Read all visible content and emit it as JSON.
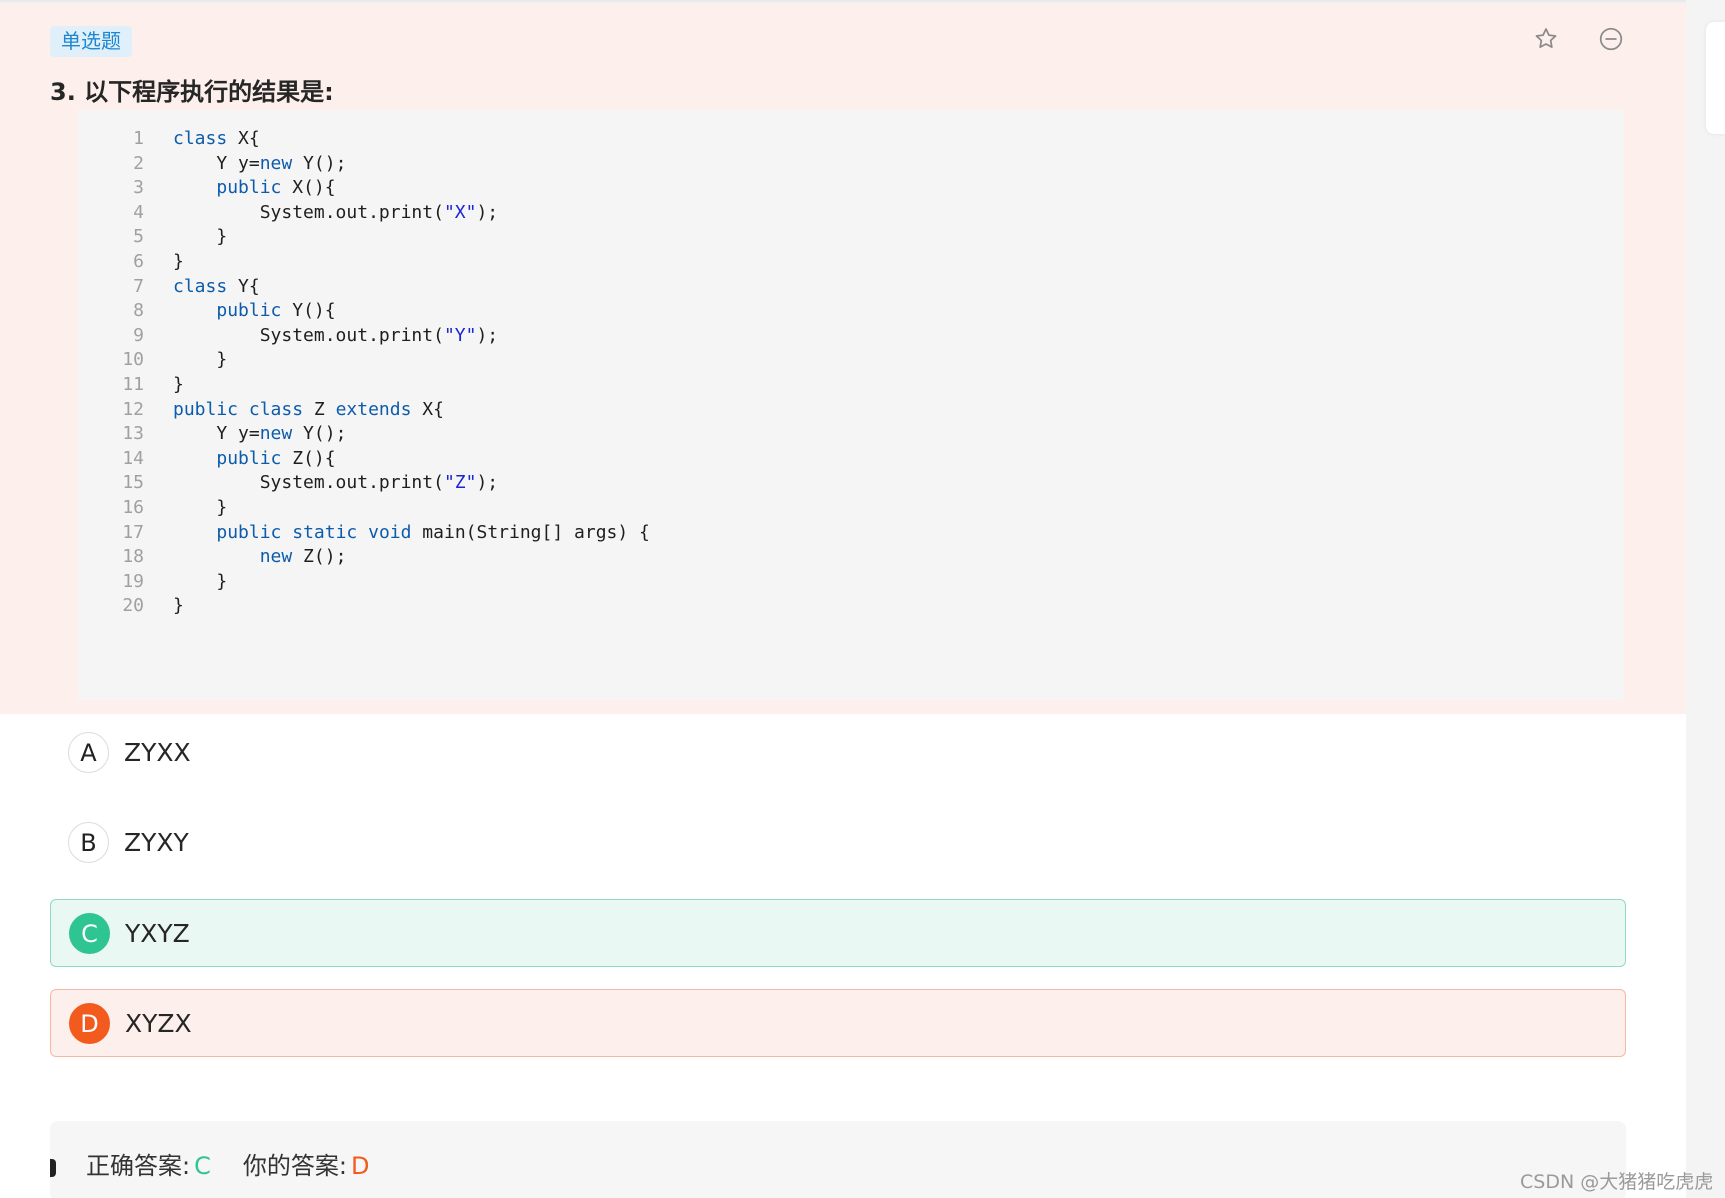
{
  "question": {
    "type_tag": "单选题",
    "title": "3. 以下程序执行的结果是:",
    "favorite_icon": "star-outline-icon",
    "remove_icon": "minus-circle-icon"
  },
  "code_lines": [
    {
      "n": "1",
      "tokens": [
        {
          "k": "kw",
          "t": "class"
        },
        {
          "k": "",
          "t": " X{"
        }
      ]
    },
    {
      "n": "2",
      "tokens": [
        {
          "k": "",
          "t": "    Y y="
        },
        {
          "k": "kw",
          "t": "new"
        },
        {
          "k": "",
          "t": " Y();"
        }
      ]
    },
    {
      "n": "3",
      "tokens": [
        {
          "k": "",
          "t": "    "
        },
        {
          "k": "kw",
          "t": "public"
        },
        {
          "k": "",
          "t": " X(){"
        }
      ]
    },
    {
      "n": "4",
      "tokens": [
        {
          "k": "",
          "t": "        System.out.print("
        },
        {
          "k": "str",
          "t": "\"X\""
        },
        {
          "k": "",
          "t": ");"
        }
      ]
    },
    {
      "n": "5",
      "tokens": [
        {
          "k": "",
          "t": "    }"
        }
      ]
    },
    {
      "n": "6",
      "tokens": [
        {
          "k": "",
          "t": "}"
        }
      ]
    },
    {
      "n": "7",
      "tokens": [
        {
          "k": "kw",
          "t": "class"
        },
        {
          "k": "",
          "t": " Y{"
        }
      ]
    },
    {
      "n": "8",
      "tokens": [
        {
          "k": "",
          "t": "    "
        },
        {
          "k": "kw",
          "t": "public"
        },
        {
          "k": "",
          "t": " Y(){"
        }
      ]
    },
    {
      "n": "9",
      "tokens": [
        {
          "k": "",
          "t": "        System.out.print("
        },
        {
          "k": "str",
          "t": "\"Y\""
        },
        {
          "k": "",
          "t": ");"
        }
      ]
    },
    {
      "n": "10",
      "tokens": [
        {
          "k": "",
          "t": "    }"
        }
      ]
    },
    {
      "n": "11",
      "tokens": [
        {
          "k": "",
          "t": "}"
        }
      ]
    },
    {
      "n": "12",
      "tokens": [
        {
          "k": "kw",
          "t": "public"
        },
        {
          "k": "",
          "t": " "
        },
        {
          "k": "kw",
          "t": "class"
        },
        {
          "k": "",
          "t": " Z "
        },
        {
          "k": "kw",
          "t": "extends"
        },
        {
          "k": "",
          "t": " X{"
        }
      ]
    },
    {
      "n": "13",
      "tokens": [
        {
          "k": "",
          "t": "    Y y="
        },
        {
          "k": "kw",
          "t": "new"
        },
        {
          "k": "",
          "t": " Y();"
        }
      ]
    },
    {
      "n": "14",
      "tokens": [
        {
          "k": "",
          "t": "    "
        },
        {
          "k": "kw",
          "t": "public"
        },
        {
          "k": "",
          "t": " Z(){"
        }
      ]
    },
    {
      "n": "15",
      "tokens": [
        {
          "k": "",
          "t": "        System.out.print("
        },
        {
          "k": "str",
          "t": "\"Z\""
        },
        {
          "k": "",
          "t": ");"
        }
      ]
    },
    {
      "n": "16",
      "tokens": [
        {
          "k": "",
          "t": "    }"
        }
      ]
    },
    {
      "n": "17",
      "tokens": [
        {
          "k": "",
          "t": "    "
        },
        {
          "k": "kw",
          "t": "public"
        },
        {
          "k": "",
          "t": " "
        },
        {
          "k": "kw",
          "t": "static"
        },
        {
          "k": "",
          "t": " "
        },
        {
          "k": "kw",
          "t": "void"
        },
        {
          "k": "",
          "t": " main(String[] args) {"
        }
      ]
    },
    {
      "n": "18",
      "tokens": [
        {
          "k": "",
          "t": "        "
        },
        {
          "k": "kw",
          "t": "new"
        },
        {
          "k": "",
          "t": " Z();"
        }
      ]
    },
    {
      "n": "19",
      "tokens": [
        {
          "k": "",
          "t": "    }"
        }
      ]
    },
    {
      "n": "20",
      "tokens": [
        {
          "k": "",
          "t": "}"
        }
      ]
    }
  ],
  "options": [
    {
      "letter": "A",
      "text": "ZYXX",
      "state": "normal"
    },
    {
      "letter": "B",
      "text": "ZYXY",
      "state": "normal"
    },
    {
      "letter": "C",
      "text": "YXYZ",
      "state": "correct"
    },
    {
      "letter": "D",
      "text": "XYZX",
      "state": "wrong"
    }
  ],
  "answer": {
    "correct_label": "正确答案:",
    "correct_value": "C",
    "yours_label": "你的答案:",
    "yours_value": "D"
  },
  "watermark": "CSDN @大猪猪吃虎虎",
  "colors": {
    "question_bg": "#fdf0ec",
    "tag_bg": "#dff0fb",
    "tag_text": "#1f86d0",
    "keyword": "#0d5bab",
    "string": "#1a23d6",
    "correct": "#2fc592",
    "wrong": "#f35a1e"
  }
}
